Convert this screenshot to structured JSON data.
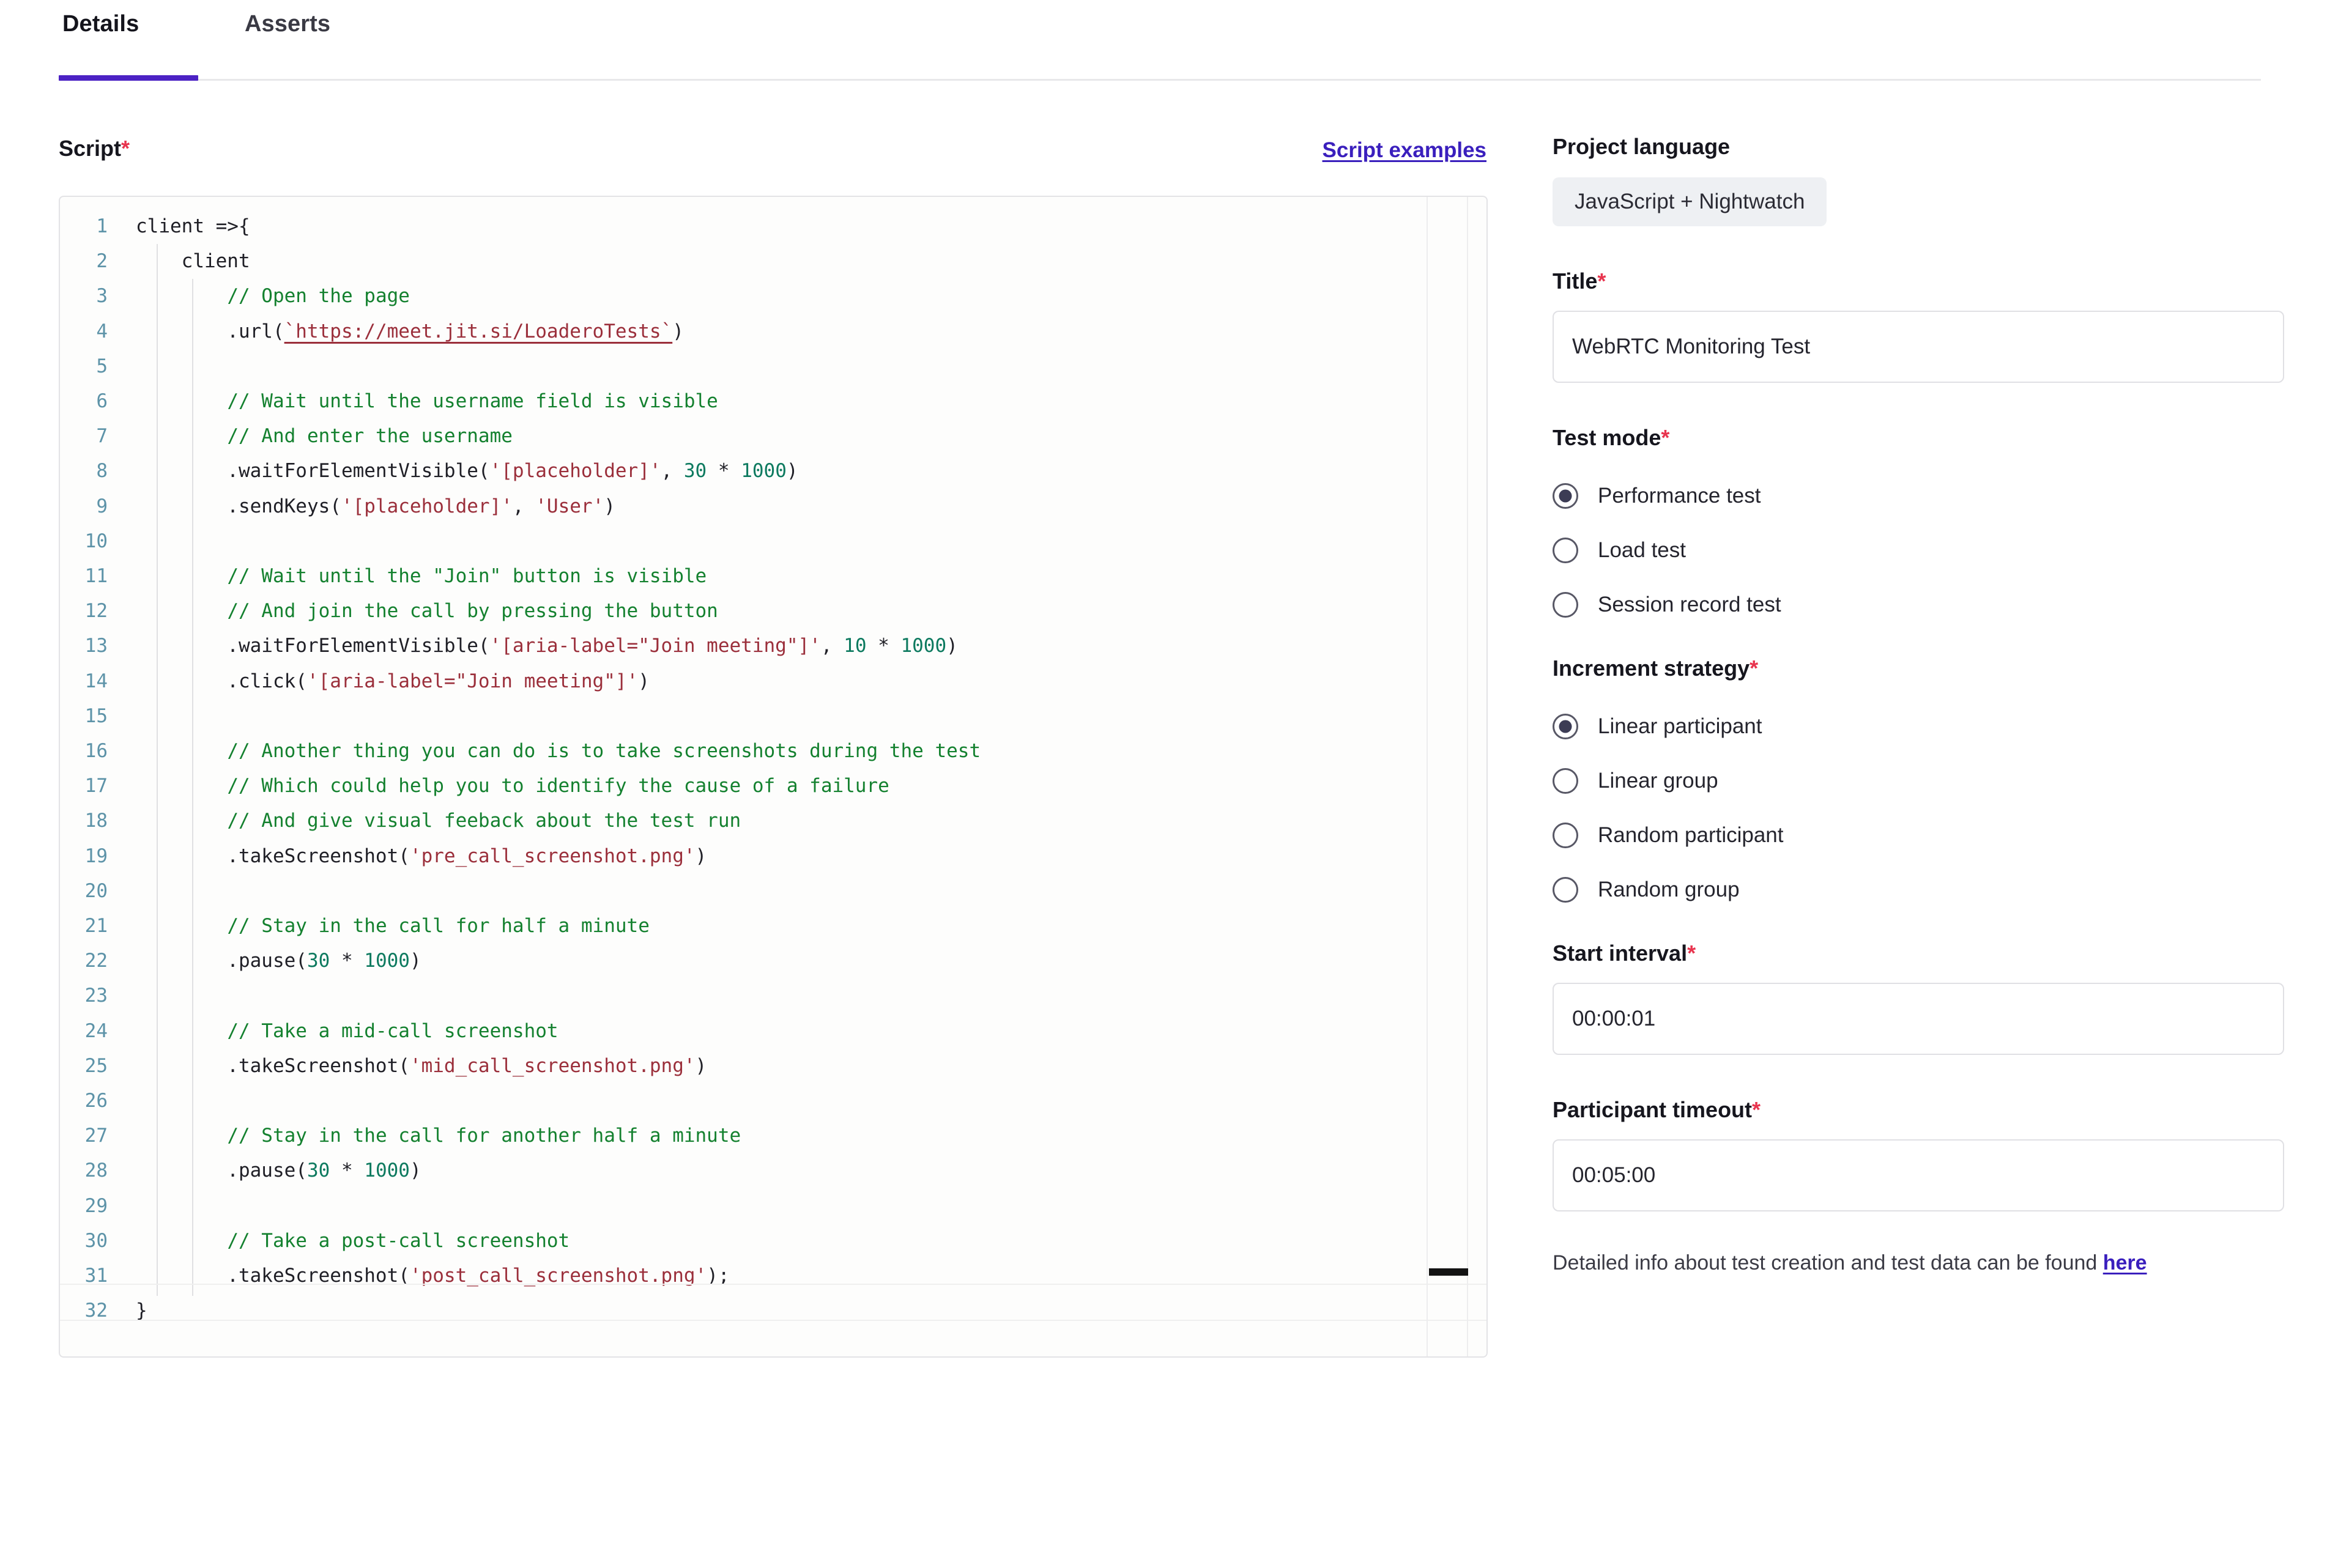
{
  "tabs": [
    {
      "id": "details",
      "label": "Details",
      "active": true
    },
    {
      "id": "asserts",
      "label": "Asserts",
      "active": false
    }
  ],
  "script_section": {
    "label": "Script",
    "required_marker": "*",
    "examples_link": "Script examples",
    "line_count": 32,
    "code_lines": [
      {
        "n": 1,
        "text": "client =>{"
      },
      {
        "n": 2,
        "text": "    client"
      },
      {
        "n": 3,
        "text": "        // Open the page"
      },
      {
        "n": 4,
        "text": "        .url(`https://meet.jit.si/LoaderoTests`)"
      },
      {
        "n": 5,
        "text": ""
      },
      {
        "n": 6,
        "text": "        // Wait until the username field is visible"
      },
      {
        "n": 7,
        "text": "        // And enter the username"
      },
      {
        "n": 8,
        "text": "        .waitForElementVisible('[placeholder]', 30 * 1000)"
      },
      {
        "n": 9,
        "text": "        .sendKeys('[placeholder]', 'User')"
      },
      {
        "n": 10,
        "text": ""
      },
      {
        "n": 11,
        "text": "        // Wait until the \"Join\" button is visible"
      },
      {
        "n": 12,
        "text": "        // And join the call by pressing the button"
      },
      {
        "n": 13,
        "text": "        .waitForElementVisible('[aria-label=\"Join meeting\"]', 10 * 1000)"
      },
      {
        "n": 14,
        "text": "        .click('[aria-label=\"Join meeting\"]')"
      },
      {
        "n": 15,
        "text": ""
      },
      {
        "n": 16,
        "text": "        // Another thing you can do is to take screenshots during the test"
      },
      {
        "n": 17,
        "text": "        // Which could help you to identify the cause of a failure"
      },
      {
        "n": 18,
        "text": "        // And give visual feeback about the test run"
      },
      {
        "n": 19,
        "text": "        .takeScreenshot('pre_call_screenshot.png')"
      },
      {
        "n": 20,
        "text": ""
      },
      {
        "n": 21,
        "text": "        // Stay in the call for half a minute"
      },
      {
        "n": 22,
        "text": "        .pause(30 * 1000)"
      },
      {
        "n": 23,
        "text": ""
      },
      {
        "n": 24,
        "text": "        // Take a mid-call screenshot"
      },
      {
        "n": 25,
        "text": "        .takeScreenshot('mid_call_screenshot.png')"
      },
      {
        "n": 26,
        "text": ""
      },
      {
        "n": 27,
        "text": "        // Stay in the call for another half a minute"
      },
      {
        "n": 28,
        "text": "        .pause(30 * 1000)"
      },
      {
        "n": 29,
        "text": ""
      },
      {
        "n": 30,
        "text": "        // Take a post-call screenshot"
      },
      {
        "n": 31,
        "text": "        .takeScreenshot('post_call_screenshot.png');"
      },
      {
        "n": 32,
        "text": "}"
      }
    ]
  },
  "form": {
    "project_language": {
      "label": "Project language",
      "value": "JavaScript + Nightwatch"
    },
    "title": {
      "label": "Title",
      "required_marker": "*",
      "value": "WebRTC Monitoring Test",
      "placeholder": ""
    },
    "test_mode": {
      "label": "Test mode",
      "required_marker": "*",
      "selected": "Performance test",
      "options": [
        "Performance test",
        "Load test",
        "Session record test"
      ]
    },
    "increment_strategy": {
      "label": "Increment strategy",
      "required_marker": "*",
      "selected": "Linear participant",
      "options": [
        "Linear participant",
        "Linear group",
        "Random participant",
        "Random group"
      ]
    },
    "start_interval": {
      "label": "Start interval",
      "required_marker": "*",
      "value": "00:00:01",
      "placeholder": "00:00:00"
    },
    "participant_timeout": {
      "label": "Participant timeout",
      "required_marker": "*",
      "value": "00:05:00",
      "placeholder": "00:00:00"
    },
    "note": {
      "text_before": "Detailed info about test creation and test data can be found ",
      "link_text": "here"
    }
  },
  "colors": {
    "accent": "#4c22c4",
    "link": "#3a1fbd",
    "required": "#e8344e",
    "comment": "#14812f",
    "string": "#9b2f3b",
    "number": "#0d7a5f",
    "gutter": "#5d93a8",
    "radio_dot": "#3c3c55"
  }
}
